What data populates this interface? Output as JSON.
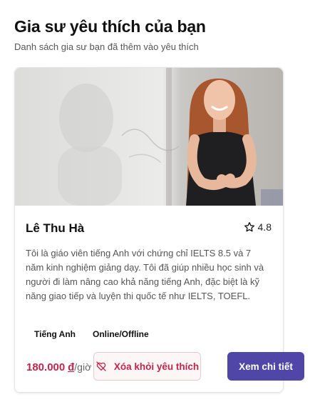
{
  "page": {
    "title": "Gia sư yêu thích của bạn",
    "subtitle": "Danh sách gia sư bạn đã thêm vào yêu thích"
  },
  "tutor_card": {
    "name": "Lê Thu Hà",
    "rating": "4.8",
    "rating_icon": "star-outline-icon",
    "bio": "Tôi là giáo viên tiếng Anh với chứng chỉ IELTS 8.5 và 7 năm kinh nghiệm giảng dạy. Tôi đã giúp nhiều học sinh và người đi làm nâng cao khả năng tiếng Anh, đặc biệt là kỹ năng giao tiếp và luyện thi quốc tế như IELTS, TOEFL.",
    "tags": [
      "Tiếng Anh",
      "Online/Offline"
    ],
    "price_amount": "180.000",
    "price_currency": "đ",
    "price_unit": "/giờ",
    "remove_button": {
      "label": "Xóa khỏi yêu thích",
      "icon": "heart-off-icon"
    },
    "detail_button": {
      "label": "Xem chi tiết"
    }
  },
  "colors": {
    "accent": "#4f46a8",
    "danger": "#c0264b",
    "danger_bg": "#fdf6f7"
  }
}
